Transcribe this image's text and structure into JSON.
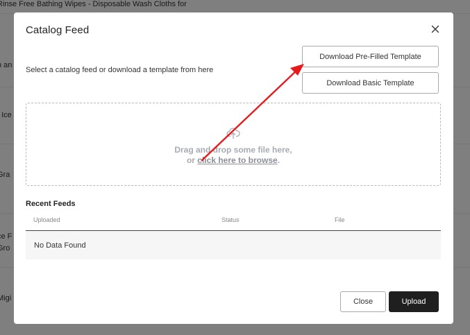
{
  "background": {
    "rows": [
      {
        "text": "Rinse Free Bathing Wipes - Disposable Wash Cloths for"
      },
      {
        "text": "n an"
      },
      {
        "text": "t Ice"
      },
      {
        "text": "Gra"
      },
      {
        "text": "ce F"
      },
      {
        "text": "Gro"
      },
      {
        "text": "Migi"
      }
    ]
  },
  "modal": {
    "title": "Catalog Feed",
    "description": "Select a catalog feed or download a template from here",
    "download_prefilled_label": "Download Pre-Filled Template",
    "download_basic_label": "Download Basic Template",
    "dropzone": {
      "line1": "Drag and drop some file here,",
      "line2_prefix": "or ",
      "browse_link": "click here to browse",
      "line2_suffix": "."
    },
    "recent_feeds": {
      "title": "Recent Feeds",
      "columns": [
        "Uploaded",
        "Status",
        "File"
      ],
      "empty_text": "No Data Found"
    },
    "footer": {
      "close_label": "Close",
      "upload_label": "Upload"
    }
  },
  "colors": {
    "annotation_arrow": "#e8191b",
    "primary_button": "#1f1f1f",
    "overlay": "rgba(0,0,0,0.5)"
  },
  "icons": {
    "close": "close-icon",
    "upload": "cloud-upload-icon"
  }
}
